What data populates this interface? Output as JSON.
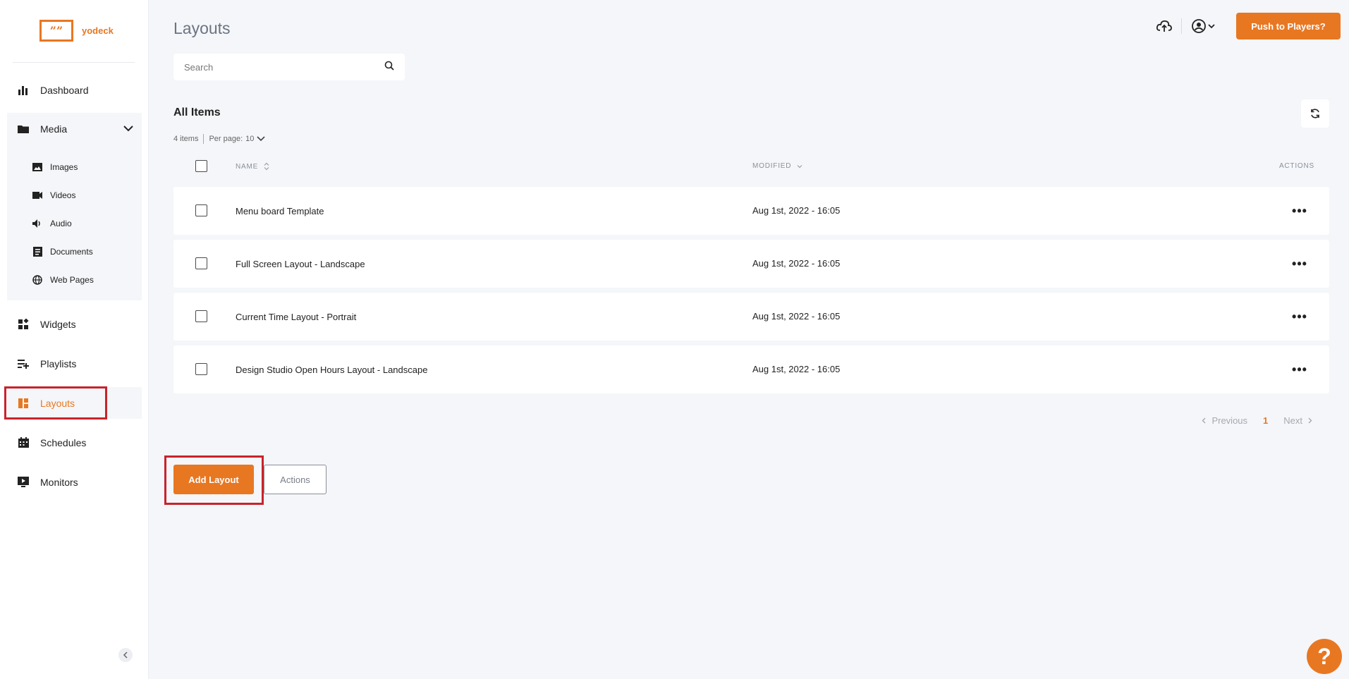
{
  "brand": {
    "name": "yodeck",
    "mark": "””",
    "accent": "#e87722",
    "highlight": "#c8232c"
  },
  "sidebar": {
    "items": [
      {
        "label": "Dashboard",
        "icon": "bar-chart-icon"
      },
      {
        "label": "Media",
        "icon": "folder-icon",
        "expanded": true
      },
      {
        "label": "Widgets",
        "icon": "widgets-icon"
      },
      {
        "label": "Playlists",
        "icon": "playlist-add-icon"
      },
      {
        "label": "Layouts",
        "icon": "layout-icon",
        "active": true
      },
      {
        "label": "Schedules",
        "icon": "calendar-icon"
      },
      {
        "label": "Monitors",
        "icon": "monitor-play-icon"
      }
    ],
    "media_sub": [
      {
        "label": "Images",
        "icon": "image-icon"
      },
      {
        "label": "Videos",
        "icon": "video-icon"
      },
      {
        "label": "Audio",
        "icon": "speaker-icon"
      },
      {
        "label": "Documents",
        "icon": "document-icon"
      },
      {
        "label": "Web Pages",
        "icon": "globe-icon"
      }
    ]
  },
  "header": {
    "title": "Layouts",
    "push_label": "Push to Players?",
    "search_placeholder": "Search"
  },
  "list": {
    "heading": "All Items",
    "count_text": "4 items",
    "per_page_label": "Per page:",
    "per_page_value": "10",
    "columns": {
      "name": "NAME",
      "modified": "MODIFIED",
      "actions": "ACTIONS"
    },
    "rows": [
      {
        "name": "Menu board Template",
        "modified": "Aug 1st, 2022 - 16:05",
        "actions": "•••"
      },
      {
        "name": "Full Screen Layout - Landscape",
        "modified": "Aug 1st, 2022 - 16:05",
        "actions": "•••"
      },
      {
        "name": "Current Time Layout - Portrait",
        "modified": "Aug 1st, 2022 - 16:05",
        "actions": "•••"
      },
      {
        "name": "Design Studio Open Hours Layout - Landscape",
        "modified": "Aug 1st, 2022 - 16:05",
        "actions": "•••"
      }
    ]
  },
  "pagination": {
    "previous": "Previous",
    "current": "1",
    "next": "Next"
  },
  "footer_actions": {
    "add_label": "Add Layout",
    "actions_label": "Actions"
  },
  "help": {
    "label": "?"
  }
}
